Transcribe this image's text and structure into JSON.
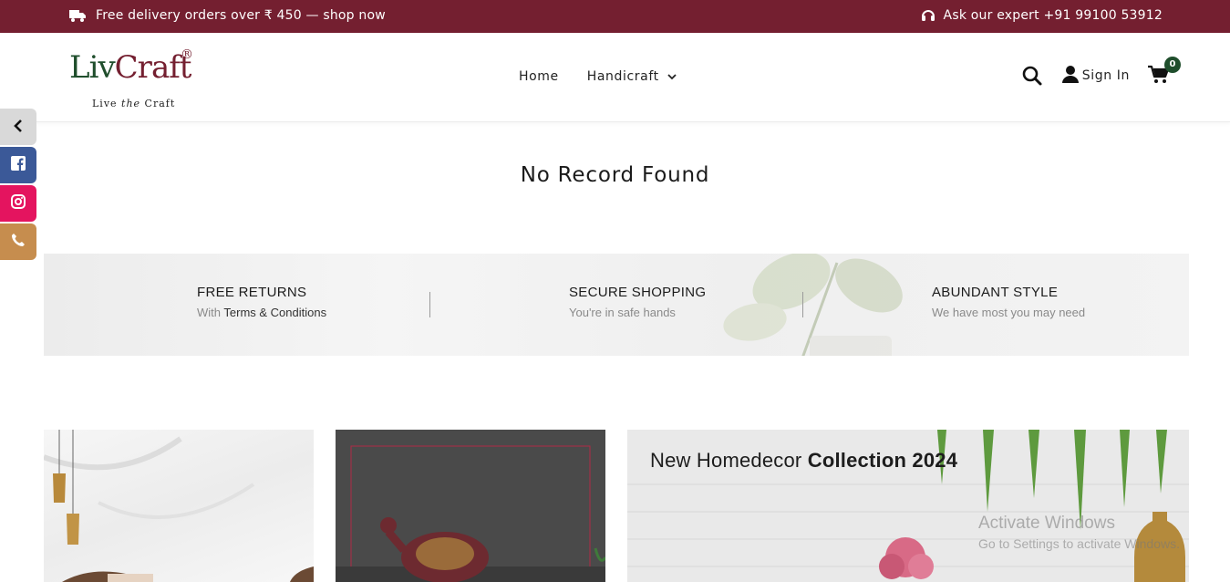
{
  "topbar": {
    "delivery_text": "Free delivery orders over ₹ 450 — shop now",
    "expert_text": "Ask our expert +91 99100 53912",
    "icons": [
      "truck-icon",
      "headset-icon"
    ]
  },
  "header": {
    "logo": {
      "text": "LivCraft",
      "reg": "®",
      "tagline_pre": "Live ",
      "tagline_em": "the",
      "tagline_post": " Craft"
    },
    "nav": {
      "home": "Home",
      "handicraft": "Handicraft"
    },
    "signin": "Sign In",
    "cart_count": "0"
  },
  "side_social": [
    "chevron-left-icon",
    "facebook-icon",
    "instagram-icon",
    "phone-icon"
  ],
  "main": {
    "message": "No Record Found"
  },
  "features": [
    {
      "title": "FREE RETURNS",
      "sub_pre": "With ",
      "sub_strong": "Terms & Conditions"
    },
    {
      "title": "SECURE SHOPPING",
      "sub": "You're in safe hands"
    },
    {
      "title": "ABUNDANT STYLE",
      "sub": "We have most you may need"
    }
  ],
  "banners": {
    "homedecor_title_pre": "New Homedecor ",
    "homedecor_title_bold": "Collection 2024"
  },
  "watermark": {
    "line1": "Activate Windows",
    "line2": "Go to Settings to activate Windows."
  },
  "colors": {
    "brand": "#741f30",
    "green": "#1f4e2c",
    "facebook": "#3b5998",
    "instagram": "#e4145f",
    "phone": "#c68d4e"
  }
}
